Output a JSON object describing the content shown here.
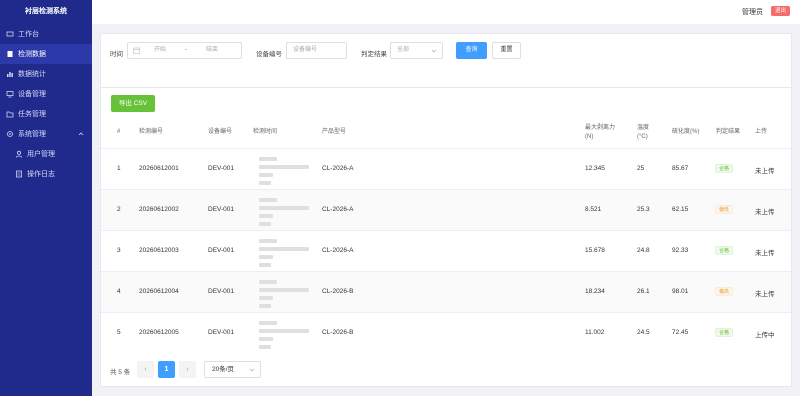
{
  "app": {
    "title": "衬层检测系统"
  },
  "sidebar": {
    "items": [
      {
        "label": "工作台",
        "icon": "desk-icon"
      },
      {
        "label": "检测数据",
        "icon": "document-icon"
      },
      {
        "label": "数据统计",
        "icon": "bar-chart-icon"
      },
      {
        "label": "设备管理",
        "icon": "monitor-icon"
      },
      {
        "label": "任务管理",
        "icon": "folder-icon"
      },
      {
        "label": "系统管理",
        "icon": "gear-icon"
      },
      {
        "label": "用户管理",
        "icon": "user-icon"
      },
      {
        "label": "操作日志",
        "icon": "log-icon"
      }
    ]
  },
  "topbar": {
    "user": "管理员",
    "logout": "退出"
  },
  "filter": {
    "time_label": "时间",
    "start_placeholder": "开始",
    "range_sep": "-",
    "end_placeholder": "结束",
    "device_label": "设备编号",
    "device_placeholder": "设备编号",
    "result_label": "判定结果",
    "result_value": "全部",
    "search_label": "查询",
    "reset_label": "重置"
  },
  "table": {
    "export_label": "导出 CSV",
    "headers": {
      "index": "#",
      "code": "检测编号",
      "device": "设备编号",
      "time": "检测时间",
      "model": "产品型号",
      "force": "最大剥离力",
      "force_unit": "(N)",
      "temp": "温度",
      "temp_unit": "(°C)",
      "cure": "硫化度(%)",
      "result": "判定结果",
      "upload": "上传"
    },
    "rows": [
      {
        "index": "1",
        "code": "20260612001",
        "device": "DEV-001",
        "model": "CL-2026-A",
        "force": "12.345",
        "temp": "25",
        "cure": "85.67",
        "result": "合格",
        "status": "ok",
        "upload": "未上传"
      },
      {
        "index": "2",
        "code": "20260612002",
        "device": "DEV-001",
        "model": "CL-2026-A",
        "force": "8.521",
        "temp": "25.3",
        "cure": "62.15",
        "result": "偏低",
        "status": "bad",
        "upload": "未上传"
      },
      {
        "index": "3",
        "code": "20260612003",
        "device": "DEV-001",
        "model": "CL-2026-A",
        "force": "15.678",
        "temp": "24.8",
        "cure": "92.33",
        "result": "合格",
        "status": "ok",
        "upload": "未上传"
      },
      {
        "index": "4",
        "code": "20260612004",
        "device": "DEV-001",
        "model": "CL-2026-B",
        "force": "18.234",
        "temp": "26.1",
        "cure": "98.01",
        "result": "偏高",
        "status": "bad",
        "upload": "未上传"
      },
      {
        "index": "5",
        "code": "20260612005",
        "device": "DEV-001",
        "model": "CL-2026-B",
        "force": "11.002",
        "temp": "24.5",
        "cure": "72.45",
        "result": "合格",
        "status": "ok",
        "upload": "上传中"
      }
    ]
  },
  "pagination": {
    "total": "共 5 条",
    "prev": "‹",
    "current": "1",
    "next": "›",
    "page_size": "20条/页"
  }
}
